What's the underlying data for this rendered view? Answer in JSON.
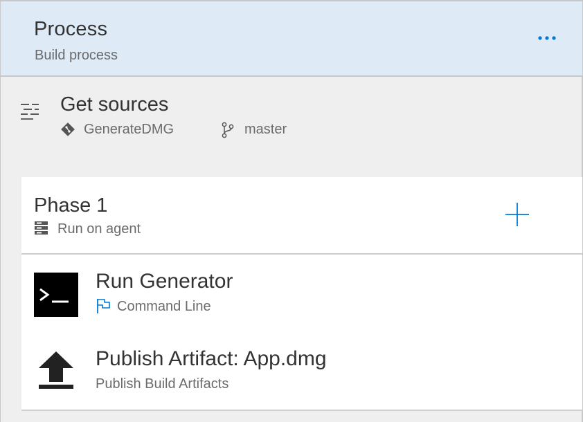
{
  "process": {
    "title": "Process",
    "subtitle": "Build process",
    "more_icon": "ellipsis-icon"
  },
  "sources": {
    "title": "Get sources",
    "repo": "GenerateDMG",
    "branch": "master",
    "icons": [
      "list-icon",
      "git-repo-icon",
      "git-branch-icon"
    ]
  },
  "phase": {
    "title": "Phase 1",
    "subtitle": "Run on agent",
    "add_icon": "plus-icon"
  },
  "tasks": [
    {
      "title": "Run Generator",
      "subtitle": "Command Line",
      "icon": "terminal-icon"
    },
    {
      "title": "Publish Artifact: App.dmg",
      "subtitle": "Publish Build Artifacts",
      "icon": "upload-icon"
    }
  ],
  "colors": {
    "header_bg": "#deebf6",
    "accent": "#0078d4",
    "page_bg": "#efefef",
    "card_bg": "#ffffff"
  }
}
